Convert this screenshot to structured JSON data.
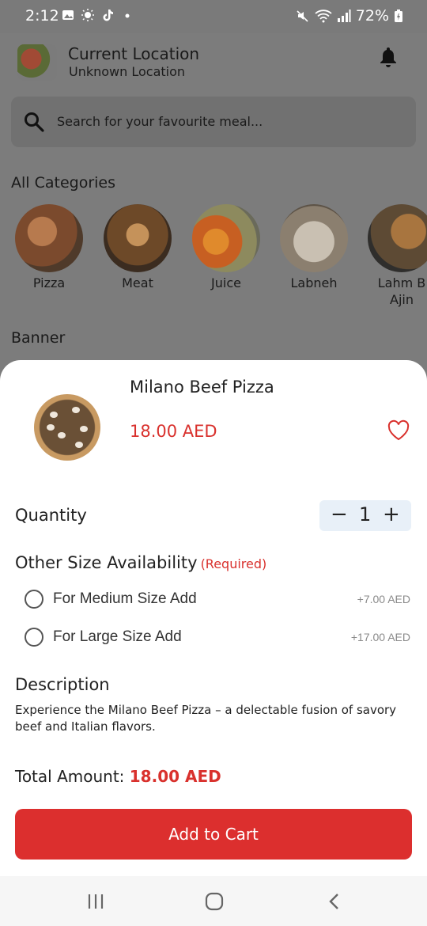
{
  "status_bar": {
    "time": "2:12",
    "battery": "72%",
    "icons": [
      "gallery-icon",
      "brightness-icon",
      "tiktok-icon",
      "dot-icon",
      "mute-icon",
      "wifi-icon",
      "signal-icon",
      "battery-icon"
    ]
  },
  "header": {
    "location_title": "Current Location",
    "location_value": "Unknown Location"
  },
  "search": {
    "placeholder": "Search for your favourite meal..."
  },
  "categories": {
    "heading": "All Categories",
    "items": [
      {
        "label": "Pizza",
        "color": "#8a4e2c"
      },
      {
        "label": "Meat",
        "color": "#6f4b2a"
      },
      {
        "label": "Juice",
        "color": "#c96a2a"
      },
      {
        "label": "Labneh",
        "color": "#9a8e7e"
      },
      {
        "label": "Lahm B",
        "label2": "Ajin",
        "color": "#5b4a36"
      }
    ]
  },
  "banner": {
    "heading": "Banner"
  },
  "product": {
    "name": "Milano Beef Pizza",
    "price": "18.00 AED",
    "quantity_label": "Quantity",
    "quantity": "1",
    "size_heading": "Other Size Availability",
    "size_required": "(Required)",
    "options": [
      {
        "label": "For Medium Size Add",
        "price": "+7.00 AED"
      },
      {
        "label": "For Large Size Add",
        "price": "+17.00 AED"
      }
    ],
    "description_heading": "Description",
    "description": "Experience the Milano Beef Pizza – a delectable fusion of savory beef and Italian flavors.",
    "total_label": "Total Amount:",
    "total_value": "18.00 AED",
    "add_button": "Add to Cart"
  },
  "colors": {
    "accent": "#dc2f2e",
    "overlay": "#7c7c7c",
    "qty_bg": "#e8f0f8"
  }
}
